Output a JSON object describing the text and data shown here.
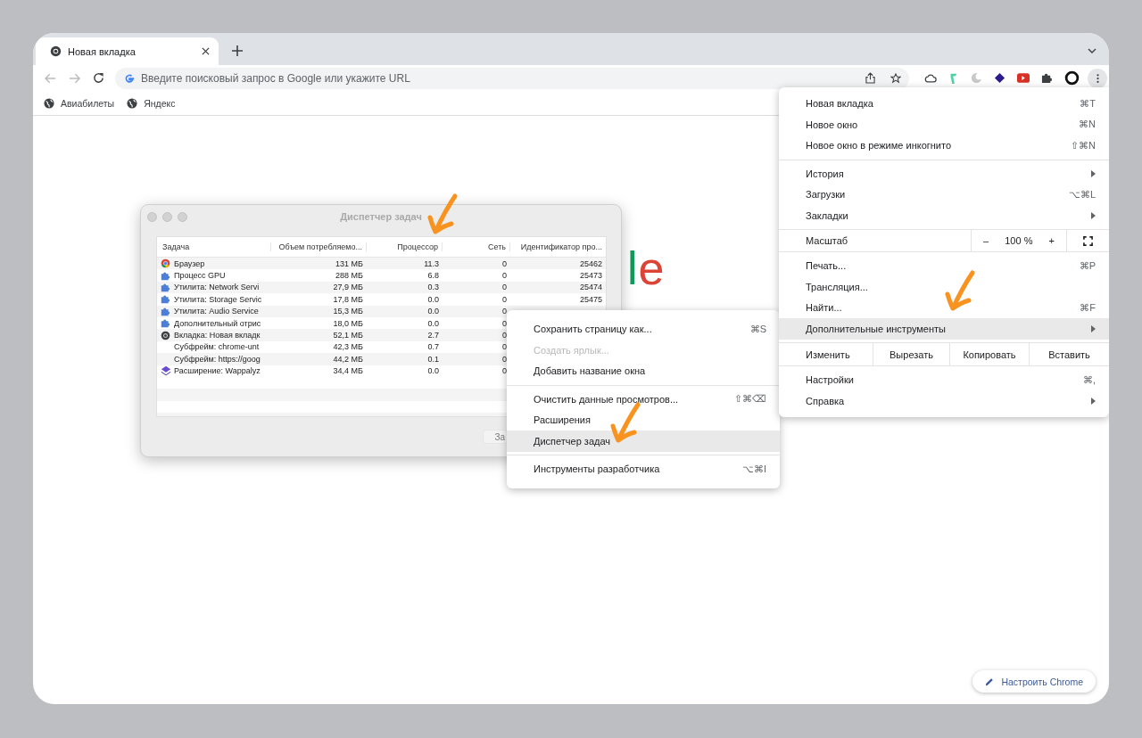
{
  "tab": {
    "title": "Новая вкладка",
    "selected": true
  },
  "omnibox": {
    "placeholder": "Введите поисковый запрос в Google или укажите URL"
  },
  "bookmarks": [
    {
      "label": "Авиабилеты"
    },
    {
      "label": "Яндекс"
    }
  ],
  "logo_fragment": "le",
  "task_manager": {
    "title": "Диспетчер задач",
    "columns": [
      "Задача",
      "Объем потребляемо...",
      "Процессор",
      "Сеть",
      "Идентификатор про..."
    ],
    "rows": [
      {
        "kind": "chrome",
        "task": "Браузер",
        "memory": "131 МБ",
        "cpu": "11.3",
        "network": "0",
        "pid": "25462"
      },
      {
        "kind": "puzzle",
        "task": "Процесс GPU",
        "memory": "288 МБ",
        "cpu": "6.8",
        "network": "0",
        "pid": "25473"
      },
      {
        "kind": "puzzle",
        "task": "Утилита: Network Servi",
        "memory": "27,9 МБ",
        "cpu": "0.3",
        "network": "0",
        "pid": "25474"
      },
      {
        "kind": "puzzle",
        "task": "Утилита: Storage Servic",
        "memory": "17,8 МБ",
        "cpu": "0.0",
        "network": "0",
        "pid": "25475"
      },
      {
        "kind": "puzzle",
        "task": "Утилита: Audio Service",
        "memory": "15,3 МБ",
        "cpu": "0.0",
        "network": "0"
      },
      {
        "kind": "puzzle",
        "task": "Дополнительный отрис",
        "memory": "18,0 МБ",
        "cpu": "0.0",
        "network": "0"
      },
      {
        "kind": "tab",
        "task": "Вкладка: Новая вкладк",
        "memory": "52,1 МБ",
        "cpu": "2.7",
        "network": "0"
      },
      {
        "kind": "subframe",
        "task": "Субфрейм: chrome-unt",
        "memory": "42,3 МБ",
        "cpu": "0.7",
        "network": "0"
      },
      {
        "kind": "subframe",
        "task": "Субфрейм: https://goog",
        "memory": "44,2 МБ",
        "cpu": "0.1",
        "network": "0"
      },
      {
        "kind": "extension",
        "task": "Расширение: Wappalyz",
        "memory": "34,4 МБ",
        "cpu": "0.0",
        "network": "0"
      }
    ],
    "end_button": "За"
  },
  "submenu": {
    "groups": [
      [
        {
          "label": "Сохранить страницу как...",
          "shortcut": "⌘S",
          "disabled": false,
          "selected": false
        },
        {
          "label": "Создать ярлык...",
          "disabled": true,
          "selected": false
        },
        {
          "label": "Добавить название окна",
          "disabled": false,
          "selected": false
        }
      ],
      [
        {
          "label": "Очистить данные просмотров...",
          "shortcut": "⇧⌘⌫",
          "disabled": false,
          "selected": false
        },
        {
          "label": "Расширения",
          "disabled": false,
          "selected": false
        },
        {
          "label": "Диспетчер задач",
          "disabled": false,
          "selected": true
        }
      ],
      [
        {
          "label": "Инструменты разработчика",
          "shortcut": "⌥⌘I",
          "disabled": false,
          "selected": false
        }
      ]
    ]
  },
  "menu": {
    "groups": [
      [
        {
          "kind": "item",
          "label": "Новая вкладка",
          "shortcut": "⌘T",
          "submenu": false,
          "selected": false
        },
        {
          "kind": "item",
          "label": "Новое окно",
          "shortcut": "⌘N",
          "submenu": false,
          "selected": false
        },
        {
          "kind": "item",
          "label": "Новое окно в режиме инкогнито",
          "shortcut": "⇧⌘N",
          "submenu": false,
          "selected": false
        }
      ],
      [
        {
          "kind": "item",
          "label": "История",
          "submenu": true,
          "selected": false
        },
        {
          "kind": "item",
          "label": "Загрузки",
          "shortcut": "⌥⌘L",
          "submenu": false,
          "selected": false
        },
        {
          "kind": "item",
          "label": "Закладки",
          "submenu": true,
          "selected": false
        }
      ],
      [
        {
          "kind": "zoom",
          "label": "Масштаб",
          "minus": "–",
          "value": "100 %",
          "plus": "+"
        }
      ],
      [
        {
          "kind": "item",
          "label": "Печать...",
          "shortcut": "⌘P",
          "submenu": false,
          "selected": false
        },
        {
          "kind": "item",
          "label": "Трансляция...",
          "submenu": false,
          "selected": false
        },
        {
          "kind": "item",
          "label": "Найти...",
          "shortcut": "⌘F",
          "submenu": false,
          "selected": false
        },
        {
          "kind": "item",
          "label": "Дополнительные инструменты",
          "submenu": true,
          "selected": true
        }
      ],
      [
        {
          "kind": "edit",
          "label": "Изменить",
          "actions": [
            "Вырезать",
            "Копировать",
            "Вставить"
          ]
        }
      ],
      [
        {
          "kind": "item",
          "label": "Настройки",
          "shortcut": "⌘,",
          "submenu": false,
          "selected": false
        },
        {
          "kind": "item",
          "label": "Справка",
          "submenu": true,
          "selected": false
        }
      ]
    ]
  },
  "customize_button": "Настроить Chrome"
}
